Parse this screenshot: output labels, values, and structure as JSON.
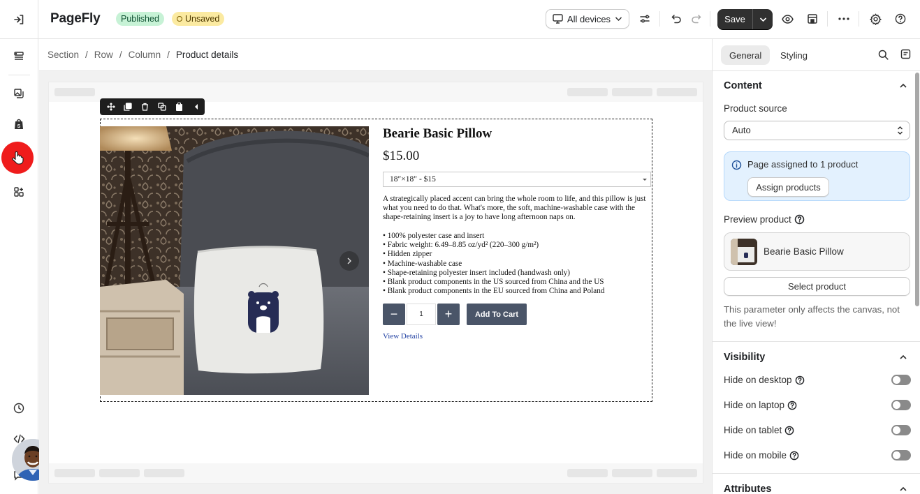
{
  "app": {
    "name": "PageFly",
    "status_published": "Published",
    "status_unsaved": "Unsaved"
  },
  "header": {
    "device_selector": "All devices",
    "save_label": "Save"
  },
  "breadcrumb": [
    "Section",
    "Row",
    "Column",
    "Product details"
  ],
  "breadcrumb_sep": "/",
  "product": {
    "title": "Bearie Basic Pillow",
    "price": "$15.00",
    "variant": "18″×18″ - $15",
    "description": "A strategically placed accent can bring the whole room to life, and this pillow is just what you need to do that. What's more, the soft, machine-washable case with the shape-retaining insert is a joy to have long afternoon naps on.",
    "bullets": [
      "• 100% polyester case and insert",
      "• Fabric weight: 6.49–8.85 oz/yd² (220–300 g/m²)",
      "• Hidden zipper",
      "• Machine-washable case",
      "• Shape-retaining polyester insert included (handwash only)",
      "• Blank product components in the US sourced from China and the US",
      "• Blank product components in the EU sourced from China and Poland"
    ],
    "quantity": "1",
    "qty_minus": "−",
    "qty_plus": "+",
    "add_to_cart": "Add To Cart",
    "view_details": "View Details"
  },
  "panel": {
    "tabs": [
      "General",
      "Styling"
    ],
    "content_title": "Content",
    "product_source_label": "Product source",
    "product_source_value": "Auto",
    "info_text": "Page assigned to 1 product",
    "assign_button": "Assign products",
    "preview_label": "Preview product",
    "preview_product": "Bearie Basic Pillow",
    "select_product_button": "Select product",
    "help_text": "This parameter only affects the canvas, not the live view!",
    "visibility_title": "Visibility",
    "visibility_items": [
      "Hide on desktop",
      "Hide on laptop",
      "Hide on tablet",
      "Hide on mobile"
    ],
    "attributes_title": "Attributes"
  },
  "colors": {
    "accent_active": "#ef1c1c",
    "published_bg": "#c7f2d6",
    "unsaved_bg": "#fbeaa1",
    "info_bg": "#e3f1fe",
    "cart_button": "#4a5568"
  }
}
